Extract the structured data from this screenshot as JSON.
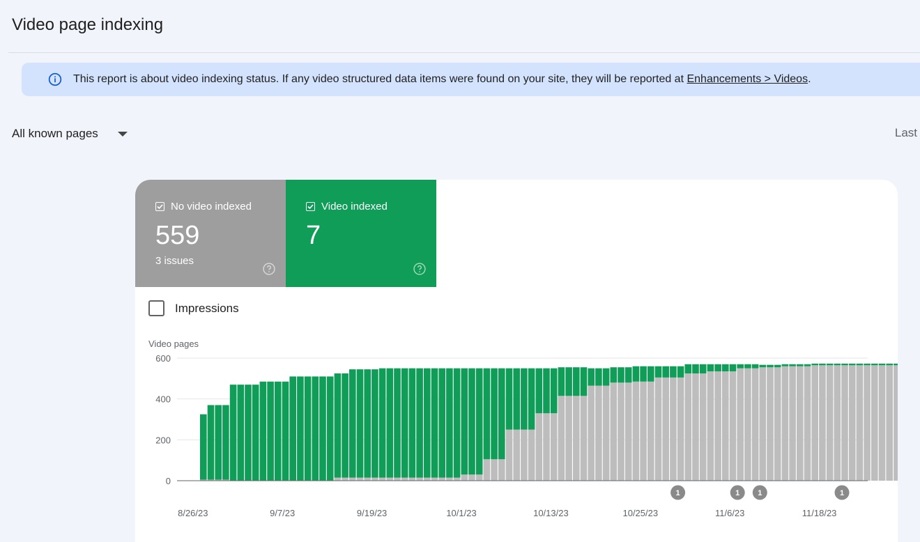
{
  "page": {
    "title": "Video page indexing"
  },
  "banner": {
    "text": "This report is about video indexing status. If any video structured data items were found on your site, they will be reported at ",
    "link": "Enhancements > Videos",
    "suffix": "."
  },
  "filter": {
    "label": "All known pages"
  },
  "date_range": {
    "label": "Last"
  },
  "tiles": {
    "no_video": {
      "label": "No video indexed",
      "value": "559",
      "sub": "3 issues",
      "color": "#9e9e9e"
    },
    "video": {
      "label": "Video indexed",
      "value": "7",
      "color": "#0f9d58"
    }
  },
  "impressions": {
    "label": "Impressions"
  },
  "chart_data": {
    "type": "bar",
    "stacked": true,
    "ylabel": "Video pages",
    "ylim": [
      0,
      600
    ],
    "yticks": [
      0,
      200,
      400,
      600
    ],
    "grid": true,
    "x_tick_labels": [
      "8/26/23",
      "9/7/23",
      "9/19/23",
      "10/1/23",
      "10/13/23",
      "10/25/23",
      "11/6/23",
      "11/18/23"
    ],
    "x_tick_bar_index": [
      0,
      12,
      24,
      36,
      48,
      60,
      72,
      84
    ],
    "series": [
      {
        "name": "No video indexed",
        "color": "#bdbdbd",
        "values": [
          5,
          5,
          5,
          5,
          0,
          0,
          0,
          0,
          0,
          0,
          0,
          0,
          0,
          0,
          0,
          0,
          0,
          0,
          15,
          15,
          15,
          15,
          15,
          15,
          15,
          15,
          15,
          15,
          15,
          15,
          15,
          15,
          15,
          15,
          15,
          30,
          30,
          30,
          105,
          105,
          105,
          250,
          250,
          250,
          250,
          330,
          330,
          330,
          415,
          415,
          415,
          415,
          465,
          465,
          465,
          480,
          480,
          480,
          485,
          485,
          485,
          505,
          505,
          505,
          505,
          525,
          525,
          525,
          535,
          535,
          535,
          535,
          550,
          550,
          550,
          555,
          555,
          555,
          560,
          560,
          560,
          560,
          565,
          565,
          565,
          565,
          565,
          565,
          565,
          565,
          565,
          565,
          565,
          565,
          565,
          565,
          565,
          565,
          565,
          565
        ]
      },
      {
        "name": "Video indexed",
        "color": "#0f9d58",
        "values": [
          320,
          365,
          365,
          365,
          470,
          470,
          470,
          470,
          485,
          485,
          485,
          485,
          510,
          510,
          510,
          510,
          510,
          510,
          510,
          510,
          530,
          530,
          530,
          530,
          535,
          535,
          535,
          535,
          535,
          535,
          535,
          535,
          535,
          535,
          535,
          520,
          520,
          520,
          445,
          445,
          445,
          300,
          300,
          300,
          300,
          220,
          220,
          220,
          140,
          140,
          140,
          140,
          85,
          85,
          85,
          75,
          75,
          75,
          75,
          75,
          75,
          55,
          55,
          55,
          55,
          45,
          45,
          45,
          35,
          35,
          35,
          35,
          20,
          20,
          20,
          12,
          12,
          12,
          10,
          10,
          10,
          10,
          8,
          8,
          8,
          8,
          8,
          8,
          8,
          8,
          8,
          8,
          8,
          8,
          8,
          8,
          7,
          7,
          7,
          7
        ]
      }
    ],
    "annotations": [
      {
        "bar_index": 64,
        "label": "1"
      },
      {
        "bar_index": 72,
        "label": "1"
      },
      {
        "bar_index": 75,
        "label": "1"
      },
      {
        "bar_index": 86,
        "label": "1"
      }
    ]
  }
}
